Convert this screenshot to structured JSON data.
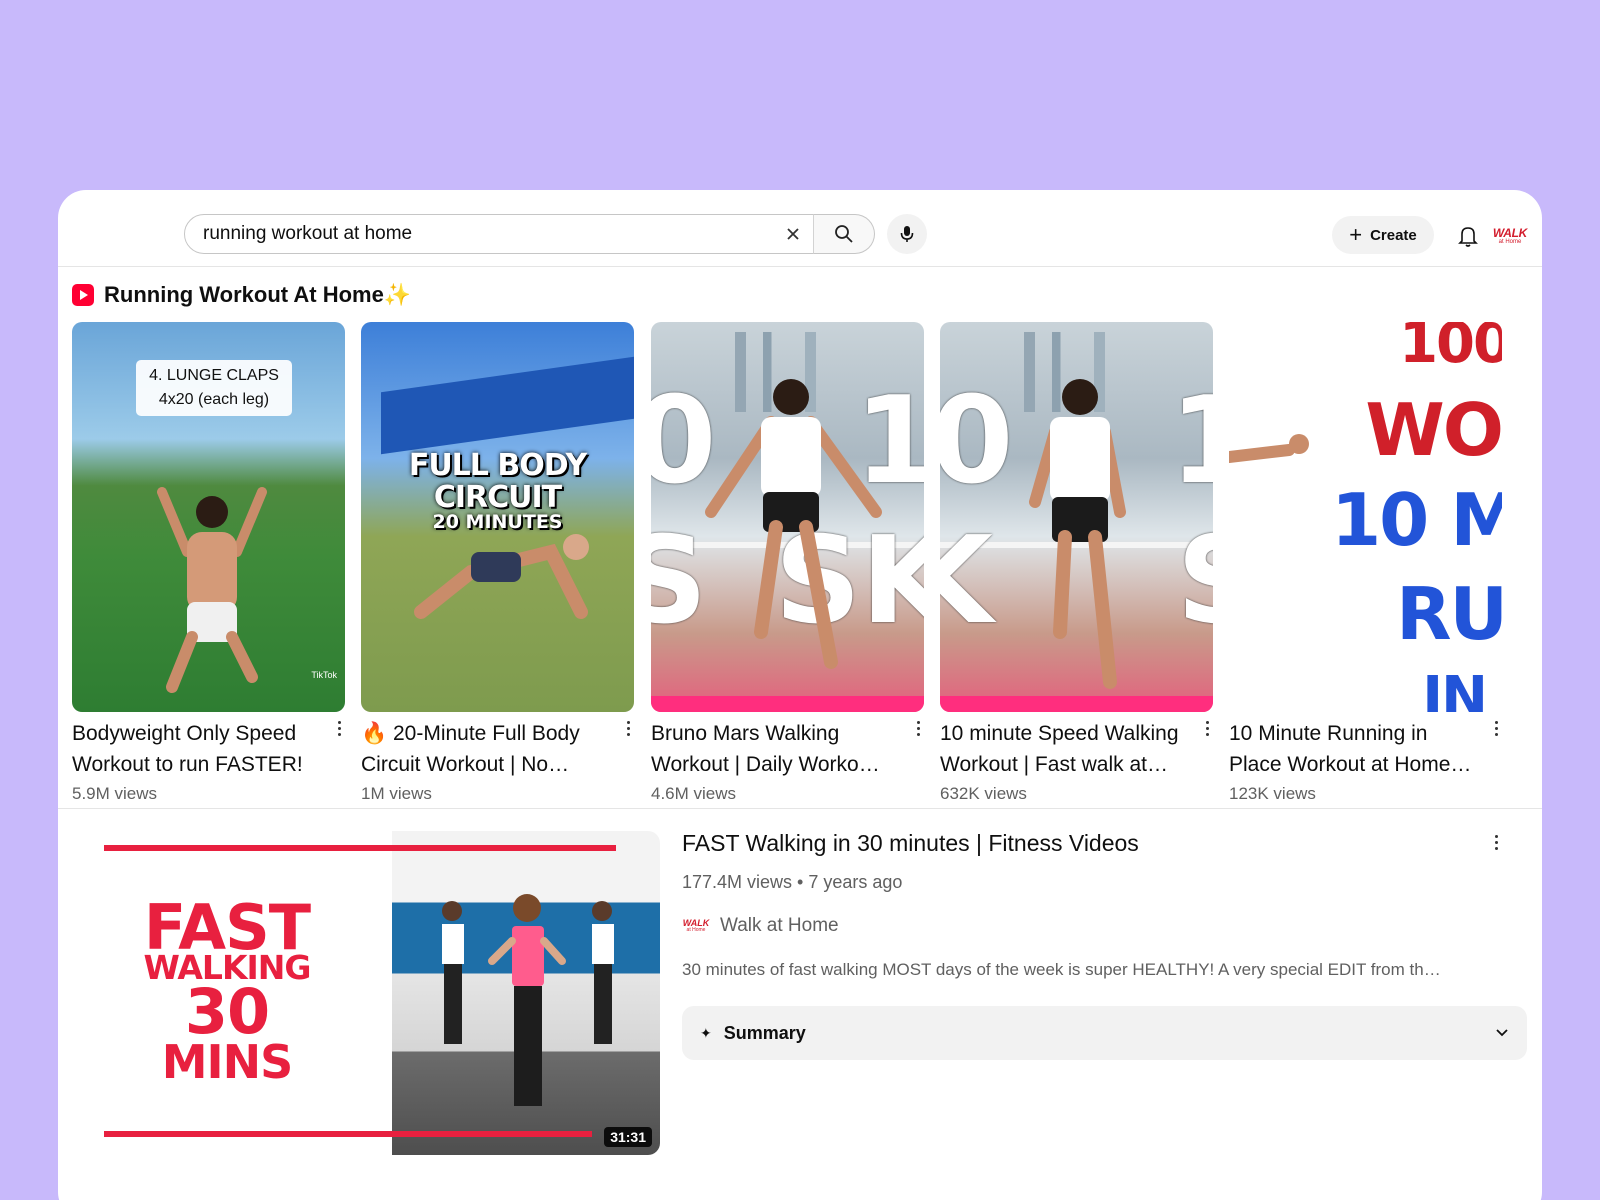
{
  "search": {
    "query": "running workout at home",
    "clear_icon": "close-icon",
    "search_icon": "search-icon",
    "mic_icon": "microphone-icon"
  },
  "header": {
    "create_label": "Create",
    "avatar_text": "WALK",
    "avatar_subtext": "at Home"
  },
  "shelf": {
    "title": "Running Workout At Home✨",
    "items": [
      {
        "title": "Bodyweight Only Speed Workout to run FASTER!",
        "views": "5.9M views",
        "caption": "4. LUNGE CLAPS 4x20 (each leg)",
        "caption_line1": "4. LUNGE CLAPS",
        "caption_line2": "4x20 (each leg)",
        "watermark": "TikTok"
      },
      {
        "title": "🔥 20-Minute Full Body Circuit Workout | No…",
        "views": "1M views",
        "overlay_line1": "FULL BODY CIRCUIT",
        "overlay_line2": "20 MINUTES"
      },
      {
        "title": "Bruno Mars Walking Workout | Daily Worko…",
        "views": "4.6M views",
        "overlay_left": "0",
        "overlay_right": "1",
        "overlay_bottom_left": "S",
        "overlay_bottom_right": "SK"
      },
      {
        "title": "10 minute Speed Walking Workout | Fast walk at…",
        "views": "632K views",
        "overlay_left": "0",
        "overlay_right": "1",
        "overlay_bottom_left": "K",
        "overlay_bottom_right": "S"
      },
      {
        "title": "10 Minute Running in Place Workout at Home…",
        "views": "123K views",
        "overlay_lines": [
          "100",
          "WO",
          "10 M",
          "RU",
          "IN"
        ]
      }
    ]
  },
  "video": {
    "title": "FAST Walking in 30 minutes | Fitness Videos",
    "meta": "177.4M views • 7 years ago",
    "channel": "Walk at Home",
    "channel_avatar_text": "WALK",
    "channel_avatar_subtext": "at Home",
    "description": "30 minutes of fast walking MOST days of the week is super HEALTHY! A very special EDIT from th…",
    "duration": "31:31",
    "thumb_line1": "FAST",
    "thumb_line2": "WALKING",
    "thumb_line3": "30",
    "thumb_line4": "MINS",
    "summary_label": "Summary"
  },
  "colors": {
    "background": "#c8b9fb",
    "brand_red": "#e8203f",
    "shorts_red": "#ff0033",
    "text_secondary": "#606060"
  }
}
